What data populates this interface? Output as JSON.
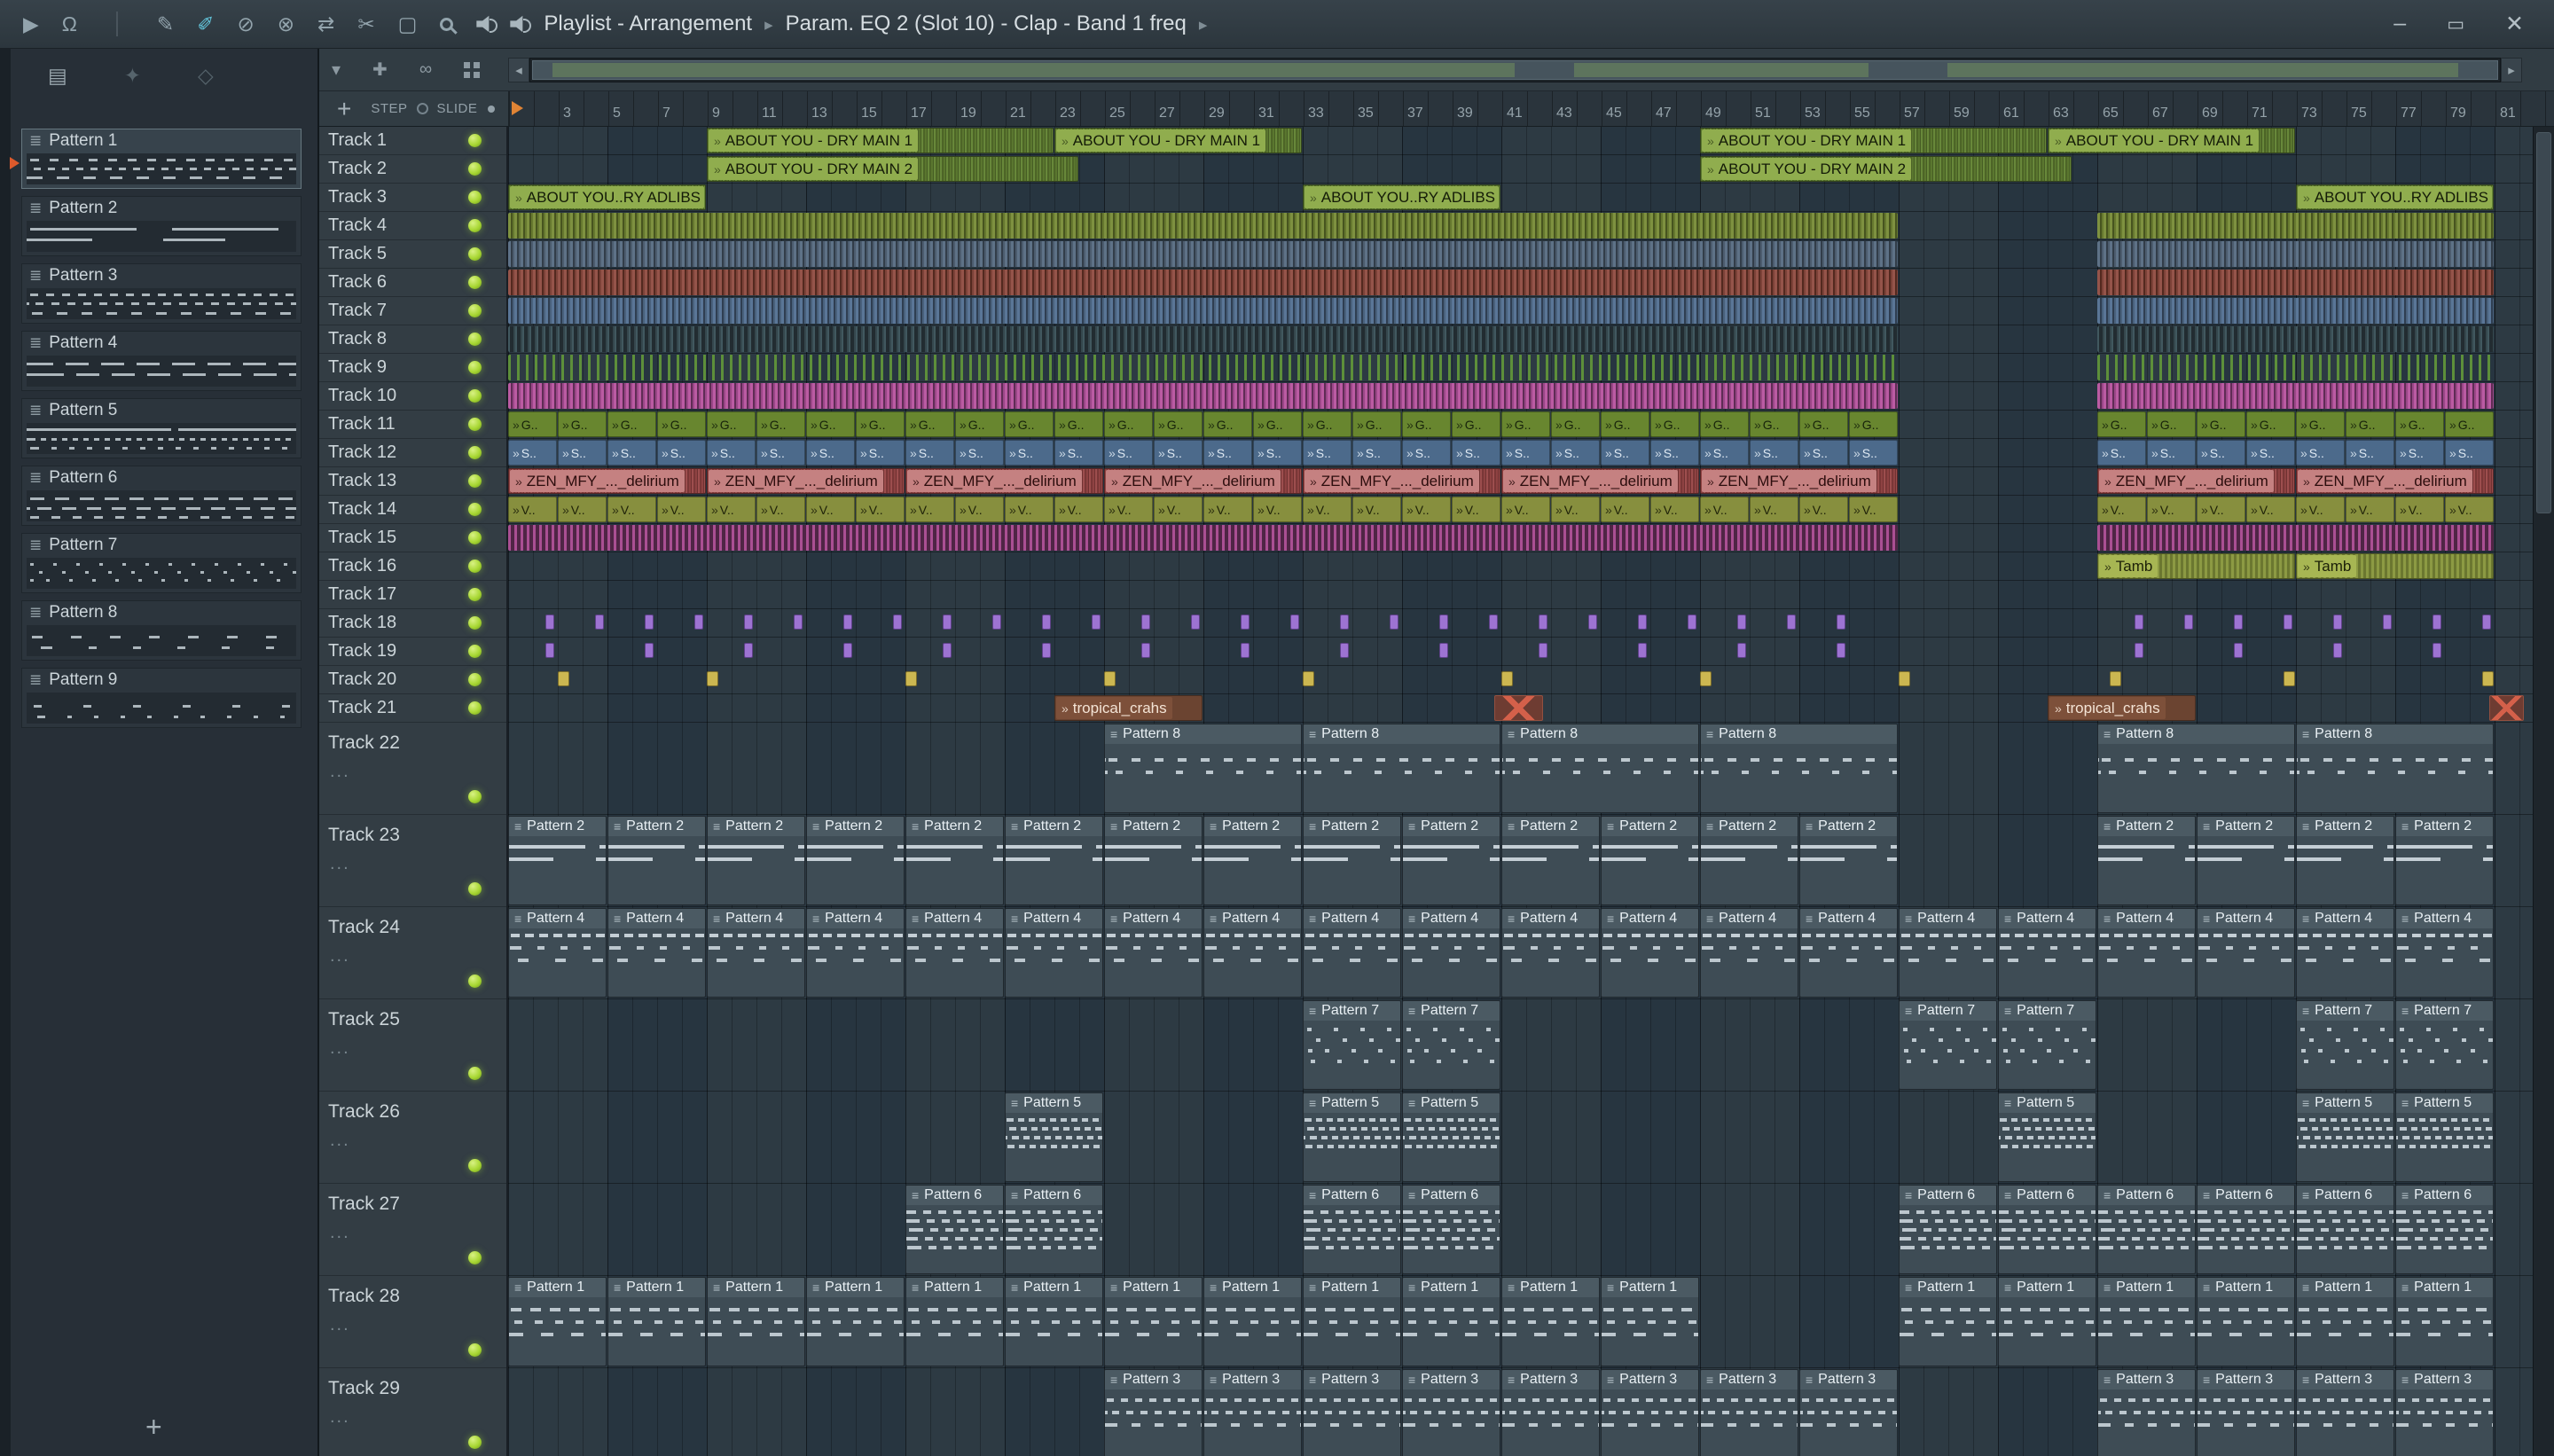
{
  "titlebar": {
    "title": "Playlist - Arrangement",
    "subtitle": "Param. EQ 2 (Slot 10) - Clap - Band 1 freq"
  },
  "pattern_panel": {
    "add_label": "+",
    "patterns": [
      {
        "name": "Pattern 1",
        "selected": true
      },
      {
        "name": "Pattern 2"
      },
      {
        "name": "Pattern 3"
      },
      {
        "name": "Pattern 4"
      },
      {
        "name": "Pattern 5"
      },
      {
        "name": "Pattern 6"
      },
      {
        "name": "Pattern 7"
      },
      {
        "name": "Pattern 8"
      },
      {
        "name": "Pattern 9"
      }
    ]
  },
  "playlist": {
    "controls": {
      "add": "+",
      "step": "STEP",
      "slide": "SLIDE"
    },
    "ruler_numbers": [
      3,
      5,
      7,
      9,
      11,
      13,
      15,
      17,
      19,
      21,
      23,
      25,
      27,
      29,
      31,
      33,
      35,
      37,
      39,
      41,
      43,
      45,
      47,
      49,
      51,
      53,
      55,
      57,
      59,
      61,
      63,
      65,
      67,
      69,
      71,
      73,
      75,
      77,
      79,
      81
    ],
    "bars_total": 81,
    "tracks": [
      {
        "name": "Track 1",
        "clips": [
          {
            "s": 9,
            "len": 14,
            "label": "ABOUT YOU - DRY MAIN 1",
            "t": "aud_g"
          },
          {
            "s": 23,
            "len": 10,
            "label": "ABOUT YOU - DRY MAIN 1",
            "t": "aud_g"
          },
          {
            "s": 49,
            "len": 14,
            "label": "ABOUT YOU - DRY MAIN 1",
            "t": "aud_g"
          },
          {
            "s": 63,
            "len": 10,
            "label": "ABOUT YOU - DRY MAIN 1",
            "t": "aud_g"
          }
        ]
      },
      {
        "name": "Track 2",
        "clips": [
          {
            "s": 9,
            "len": 15,
            "label": "ABOUT YOU - DRY MAIN 2",
            "t": "aud_g"
          },
          {
            "s": 49,
            "len": 15,
            "label": "ABOUT YOU - DRY MAIN 2",
            "t": "aud_g"
          }
        ]
      },
      {
        "name": "Track 3",
        "clips": [
          {
            "s": 1,
            "len": 8,
            "label": "ABOUT YOU..RY ADLIBS",
            "t": "aud_g"
          },
          {
            "s": 33,
            "len": 8,
            "label": "ABOUT YOU..RY ADLIBS",
            "t": "aud_g"
          },
          {
            "s": 73,
            "len": 8,
            "label": "ABOUT YOU..RY ADLIBS",
            "t": "aud_g"
          }
        ]
      },
      {
        "name": "Track 4",
        "clips": [
          {
            "s": 1,
            "len": 56,
            "t": "st_olive"
          },
          {
            "s": 65,
            "len": 16,
            "t": "st_olive"
          }
        ]
      },
      {
        "name": "Track 5",
        "clips": [
          {
            "s": 1,
            "len": 56,
            "t": "st_slate"
          },
          {
            "s": 65,
            "len": 16,
            "t": "st_slate"
          }
        ]
      },
      {
        "name": "Track 6",
        "clips": [
          {
            "s": 1,
            "len": 56,
            "t": "st_red"
          },
          {
            "s": 65,
            "len": 16,
            "t": "st_red"
          }
        ]
      },
      {
        "name": "Track 7",
        "clips": [
          {
            "s": 1,
            "len": 56,
            "t": "st_blue"
          },
          {
            "s": 65,
            "len": 16,
            "t": "st_blue"
          }
        ]
      },
      {
        "name": "Track 8",
        "clips": [
          {
            "s": 1,
            "len": 56,
            "t": "st_teal"
          },
          {
            "s": 65,
            "len": 16,
            "t": "st_teal"
          }
        ]
      },
      {
        "name": "Track 9",
        "clips": [
          {
            "s": 1,
            "len": 56,
            "t": "st_green"
          },
          {
            "s": 65,
            "len": 16,
            "t": "st_green"
          }
        ]
      },
      {
        "name": "Track 10",
        "clips": [
          {
            "s": 1,
            "len": 56,
            "t": "st_mag"
          },
          {
            "s": 65,
            "len": 16,
            "t": "st_mag"
          }
        ]
      },
      {
        "name": "Track 11",
        "clips": [
          {
            "s": 1,
            "len": 2,
            "n": 28,
            "label": "G..",
            "t": "pat_g"
          },
          {
            "s": 65,
            "len": 2,
            "n": 8,
            "label": "G..",
            "t": "pat_g"
          }
        ]
      },
      {
        "name": "Track 12",
        "clips": [
          {
            "s": 1,
            "len": 2,
            "n": 28,
            "label": "S..",
            "t": "pat_b"
          },
          {
            "s": 65,
            "len": 2,
            "n": 8,
            "label": "S..",
            "t": "pat_b"
          }
        ]
      },
      {
        "name": "Track 13",
        "clips": [
          {
            "s": 1,
            "len": 8,
            "n": 7,
            "label": "ZEN_MFY_..._delirium",
            "t": "aud_red"
          },
          {
            "s": 65,
            "len": 8,
            "n": 2,
            "label": "ZEN_MFY_..._delirium",
            "t": "aud_red"
          }
        ]
      },
      {
        "name": "Track 14",
        "clips": [
          {
            "s": 1,
            "len": 2,
            "n": 28,
            "label": "V..",
            "t": "pat_v"
          },
          {
            "s": 65,
            "len": 2,
            "n": 8,
            "label": "V..",
            "t": "pat_v"
          }
        ]
      },
      {
        "name": "Track 15",
        "clips": [
          {
            "s": 1,
            "len": 56,
            "t": "st_mag2"
          },
          {
            "s": 65,
            "len": 16,
            "t": "st_mag2"
          }
        ]
      },
      {
        "name": "Track 16",
        "clips": [
          {
            "s": 65,
            "len": 8,
            "label": "Tamb",
            "t": "aud_tamb"
          },
          {
            "s": 73,
            "len": 8,
            "label": "Tamb",
            "t": "aud_tamb"
          }
        ]
      },
      {
        "name": "Track 17",
        "clips": []
      },
      {
        "name": "Track 18",
        "clips": [
          {
            "s": 2.5,
            "len": 0.4,
            "n": 27,
            "step": 2,
            "t": "note_p"
          },
          {
            "s": 66.5,
            "len": 0.4,
            "n": 8,
            "step": 2,
            "t": "note_p"
          }
        ]
      },
      {
        "name": "Track 19",
        "clips": [
          {
            "s": 2.5,
            "len": 0.4,
            "n": 14,
            "step": 4,
            "t": "note_p"
          },
          {
            "s": 66.5,
            "len": 0.4,
            "n": 4,
            "step": 4,
            "t": "note_p"
          }
        ]
      },
      {
        "name": "Track 20",
        "clips": [
          {
            "s": 3,
            "len": 0.5,
            "t": "note_y"
          },
          {
            "s": 9,
            "len": 0.5,
            "n": 7,
            "step": 8,
            "t": "note_y"
          },
          {
            "s": 65.5,
            "len": 0.5,
            "t": "note_y"
          },
          {
            "s": 72.5,
            "len": 0.5,
            "t": "note_y"
          },
          {
            "s": 80.5,
            "len": 0.5,
            "t": "note_y"
          }
        ]
      },
      {
        "name": "Track 21",
        "clips": [
          {
            "s": 23,
            "len": 6,
            "label": "tropical_crahs",
            "t": "aud_brown"
          },
          {
            "s": 40.7,
            "len": 2,
            "t": "aud_x"
          },
          {
            "s": 63,
            "len": 6,
            "label": "tropical_crahs",
            "t": "aud_brown"
          },
          {
            "s": 80.8,
            "len": 1.4,
            "t": "aud_x"
          }
        ]
      },
      {
        "name": "Track 22",
        "tall": true,
        "clips": [
          {
            "s": 25,
            "len": 8,
            "n": 4,
            "label": "Pattern 8",
            "t": "pc p8"
          },
          {
            "s": 65,
            "len": 8,
            "n": 2,
            "label": "Pattern 8",
            "t": "pc p8"
          }
        ]
      },
      {
        "name": "Track 23",
        "tall": true,
        "clips": [
          {
            "s": 1,
            "len": 4,
            "n": 14,
            "label": "Pattern 2",
            "t": "pc p2"
          },
          {
            "s": 65,
            "len": 4,
            "n": 4,
            "label": "Pattern 2",
            "t": "pc p2"
          }
        ]
      },
      {
        "name": "Track 24",
        "tall": true,
        "clips": [
          {
            "s": 1,
            "len": 4,
            "n": 20,
            "label": "Pattern 4",
            "t": "pc p4"
          }
        ]
      },
      {
        "name": "Track 25",
        "tall": true,
        "clips": [
          {
            "s": 33,
            "len": 4,
            "n": 2,
            "label": "Pattern 7",
            "t": "pc p7"
          },
          {
            "s": 57,
            "len": 4,
            "n": 2,
            "label": "Pattern 7",
            "t": "pc p7"
          },
          {
            "s": 73,
            "len": 4,
            "n": 2,
            "label": "Pattern 7",
            "t": "pc p7"
          }
        ]
      },
      {
        "name": "Track 26",
        "tall": true,
        "clips": [
          {
            "s": 21,
            "len": 4,
            "label": "Pattern 5",
            "t": "pc p5"
          },
          {
            "s": 33,
            "len": 4,
            "n": 2,
            "label": "Pattern 5",
            "t": "pc p5"
          },
          {
            "s": 61,
            "len": 4,
            "label": "Pattern 5",
            "t": "pc p5"
          },
          {
            "s": 73,
            "len": 4,
            "n": 2,
            "label": "Pattern 5",
            "t": "pc p5"
          }
        ]
      },
      {
        "name": "Track 27",
        "tall": true,
        "clips": [
          {
            "s": 17,
            "len": 4,
            "n": 2,
            "label": "Pattern 6",
            "t": "pc p6"
          },
          {
            "s": 33,
            "len": 4,
            "n": 2,
            "label": "Pattern 6",
            "t": "pc p6"
          },
          {
            "s": 57,
            "len": 4,
            "n": 6,
            "label": "Pattern 6",
            "t": "pc p6"
          }
        ]
      },
      {
        "name": "Track 28",
        "tall": true,
        "clips": [
          {
            "s": 1,
            "len": 4,
            "n": 12,
            "label": "Pattern 1",
            "t": "pc p1"
          },
          {
            "s": 57,
            "len": 4,
            "n": 6,
            "label": "Pattern 1",
            "t": "pc p1"
          }
        ]
      },
      {
        "name": "Track 29",
        "tall": true,
        "clips": [
          {
            "s": 25,
            "len": 4,
            "n": 8,
            "label": "Pattern 3",
            "t": "pc p3"
          },
          {
            "s": 65,
            "len": 4,
            "n": 4,
            "label": "Pattern 3",
            "t": "pc p3"
          }
        ]
      }
    ]
  },
  "colors": {
    "led_green": "#a8d733",
    "audio_green": "#68883a",
    "audio_red": "#9d4e4e",
    "magenta": "#bb5ba3",
    "olive": "#8c9a43",
    "slate_blue": "#5a7697",
    "purple_note": "#9d73d2",
    "yellow_note": "#ccb751",
    "brown": "#6b4431",
    "playhead_orange": "#e08435"
  }
}
